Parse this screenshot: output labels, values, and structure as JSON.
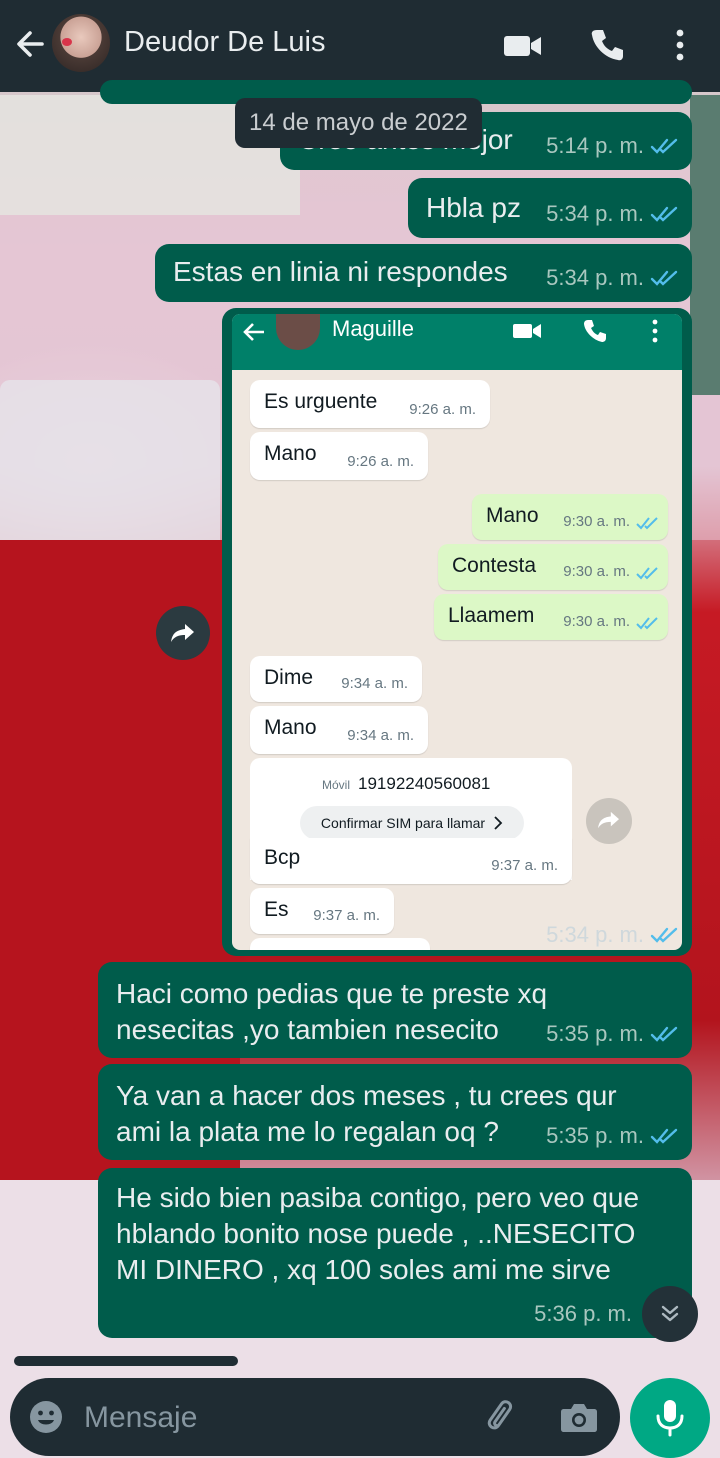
{
  "header": {
    "contact_name": "Deudor De Luis"
  },
  "date_chip": "14 de mayo de 2022",
  "messages": [
    {
      "text": "Creo antes mejor",
      "time": "5:14 p. m.",
      "status": "read"
    },
    {
      "text": "Hbla pz",
      "time": "5:34 p. m.",
      "status": "read"
    },
    {
      "text": "Estas en linia ni respondes",
      "time": "5:34 p. m.",
      "status": "read"
    },
    {
      "text": "Haci como pedias que te preste xq",
      "text2": "nesecitas ,yo tambien nesecito",
      "time": "5:35 p. m.",
      "status": "read"
    },
    {
      "text": "Ya van a hacer dos meses , tu crees qur",
      "text2": "ami la plata me lo regalan oq ?",
      "time": "5:35 p. m.",
      "status": "read"
    },
    {
      "text": "He sido bien pasiba contigo, pero veo que",
      "text2": "hblando bonito nose puede , ..NESECITO",
      "text3": "MI DINERO , xq 100 soles ami me sirve",
      "time": "5:36 p. m.",
      "status": "read"
    }
  ],
  "image_message": {
    "time": "5:34 p. m.",
    "status": "read",
    "screenshot": {
      "contact_name": "Maguille",
      "messages": [
        {
          "dir": "in",
          "text": "Es urguente",
          "time": "9:26 a. m."
        },
        {
          "dir": "in",
          "text": "Mano",
          "time": "9:26 a. m."
        },
        {
          "dir": "out",
          "text": "Mano",
          "time": "9:30 a. m."
        },
        {
          "dir": "out",
          "text": "Contesta",
          "time": "9:30 a. m."
        },
        {
          "dir": "out",
          "text": "Llaamem",
          "time": "9:30 a. m."
        },
        {
          "dir": "in",
          "text": "Dime",
          "time": "9:34 a. m."
        },
        {
          "dir": "in",
          "text": "Mano",
          "time": "9:34 a. m."
        },
        {
          "dir": "in",
          "text": "Bcp",
          "time": "9:37 a. m."
        },
        {
          "dir": "in",
          "text": "Es",
          "time": "9:37 a. m."
        }
      ],
      "phone_card": {
        "label": "Móvil",
        "number": "19192240560081",
        "button": "Confirmar SIM para llamar"
      }
    }
  },
  "composer": {
    "placeholder": "Mensaje"
  },
  "colors": {
    "header_bg": "#1f2c33",
    "outgoing_bubble": "#005c4b",
    "read_ticks": "#53bdeb",
    "accent": "#00a884"
  }
}
